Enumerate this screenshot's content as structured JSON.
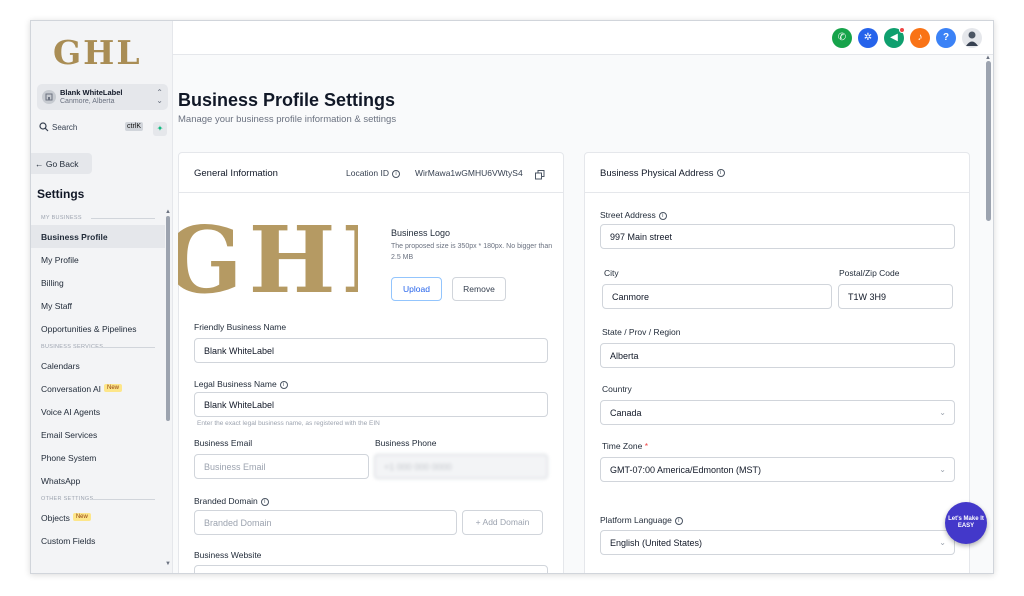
{
  "brand": {
    "logo_text": "GHL",
    "accent": "#a98d55"
  },
  "location": {
    "name": "Blank WhiteLabel",
    "sub": "Canmore, Alberta"
  },
  "search": {
    "label": "Search",
    "shortcut": "ctrlK"
  },
  "go_back": "← Go Back",
  "settings_title": "Settings",
  "nav": {
    "section_business": "MY BUSINESS",
    "business_profile": "Business Profile",
    "my_profile": "My Profile",
    "billing": "Billing",
    "my_staff": "My Staff",
    "opportunities": "Opportunities & Pipelines",
    "section_services": "BUSINESS SERVICES",
    "calendars": "Calendars",
    "conversation_ai": "Conversation AI",
    "new_badge": "New",
    "voice_ai": "Voice AI Agents",
    "email_services": "Email Services",
    "phone_system": "Phone System",
    "whatsapp": "WhatsApp",
    "section_other": "OTHER SETTINGS",
    "objects": "Objects",
    "custom_fields": "Custom Fields"
  },
  "header_icons": [
    "phone-icon",
    "compass-icon",
    "megaphone-icon",
    "bell-icon",
    "help-icon",
    "user-avatar"
  ],
  "page": {
    "title": "Business Profile Settings",
    "subtitle": "Manage your business profile information & settings"
  },
  "general": {
    "title": "General Information",
    "location_id_label": "Location ID",
    "location_id_value": "WirMawa1wGMHU6VWtyS4",
    "logo_label": "Business Logo",
    "logo_hint": "The proposed size is 350px * 180px. No bigger than 2.5 MB",
    "upload": "Upload",
    "remove": "Remove",
    "friendly_name_label": "Friendly Business Name",
    "friendly_name_value": "Blank WhiteLabel",
    "legal_name_label": "Legal Business Name",
    "legal_name_value": "Blank WhiteLabel",
    "legal_name_hint": "Enter the exact legal business name, as registered with the EIN",
    "email_label": "Business Email",
    "email_placeholder": "Business Email",
    "phone_label": "Business Phone",
    "phone_value": "+1 000 000 0000",
    "domain_label": "Branded Domain",
    "domain_placeholder": "Branded Domain",
    "add_domain": "+ Add Domain",
    "website_label": "Business Website"
  },
  "address": {
    "title": "Business Physical Address",
    "street_label": "Street Address",
    "street_value": "997 Main street",
    "city_label": "City",
    "city_value": "Canmore",
    "zip_label": "Postal/Zip Code",
    "zip_value": "T1W 3H9",
    "state_label": "State / Prov / Region",
    "state_value": "Alberta",
    "country_label": "Country",
    "country_value": "Canada",
    "tz_label": "Time Zone",
    "tz_required": "*",
    "tz_value": "GMT-07:00 America/Edmonton (MST)",
    "lang_label": "Platform Language",
    "lang_value": "English (United States)"
  },
  "chat_bubble": "Let's Make It EASY"
}
